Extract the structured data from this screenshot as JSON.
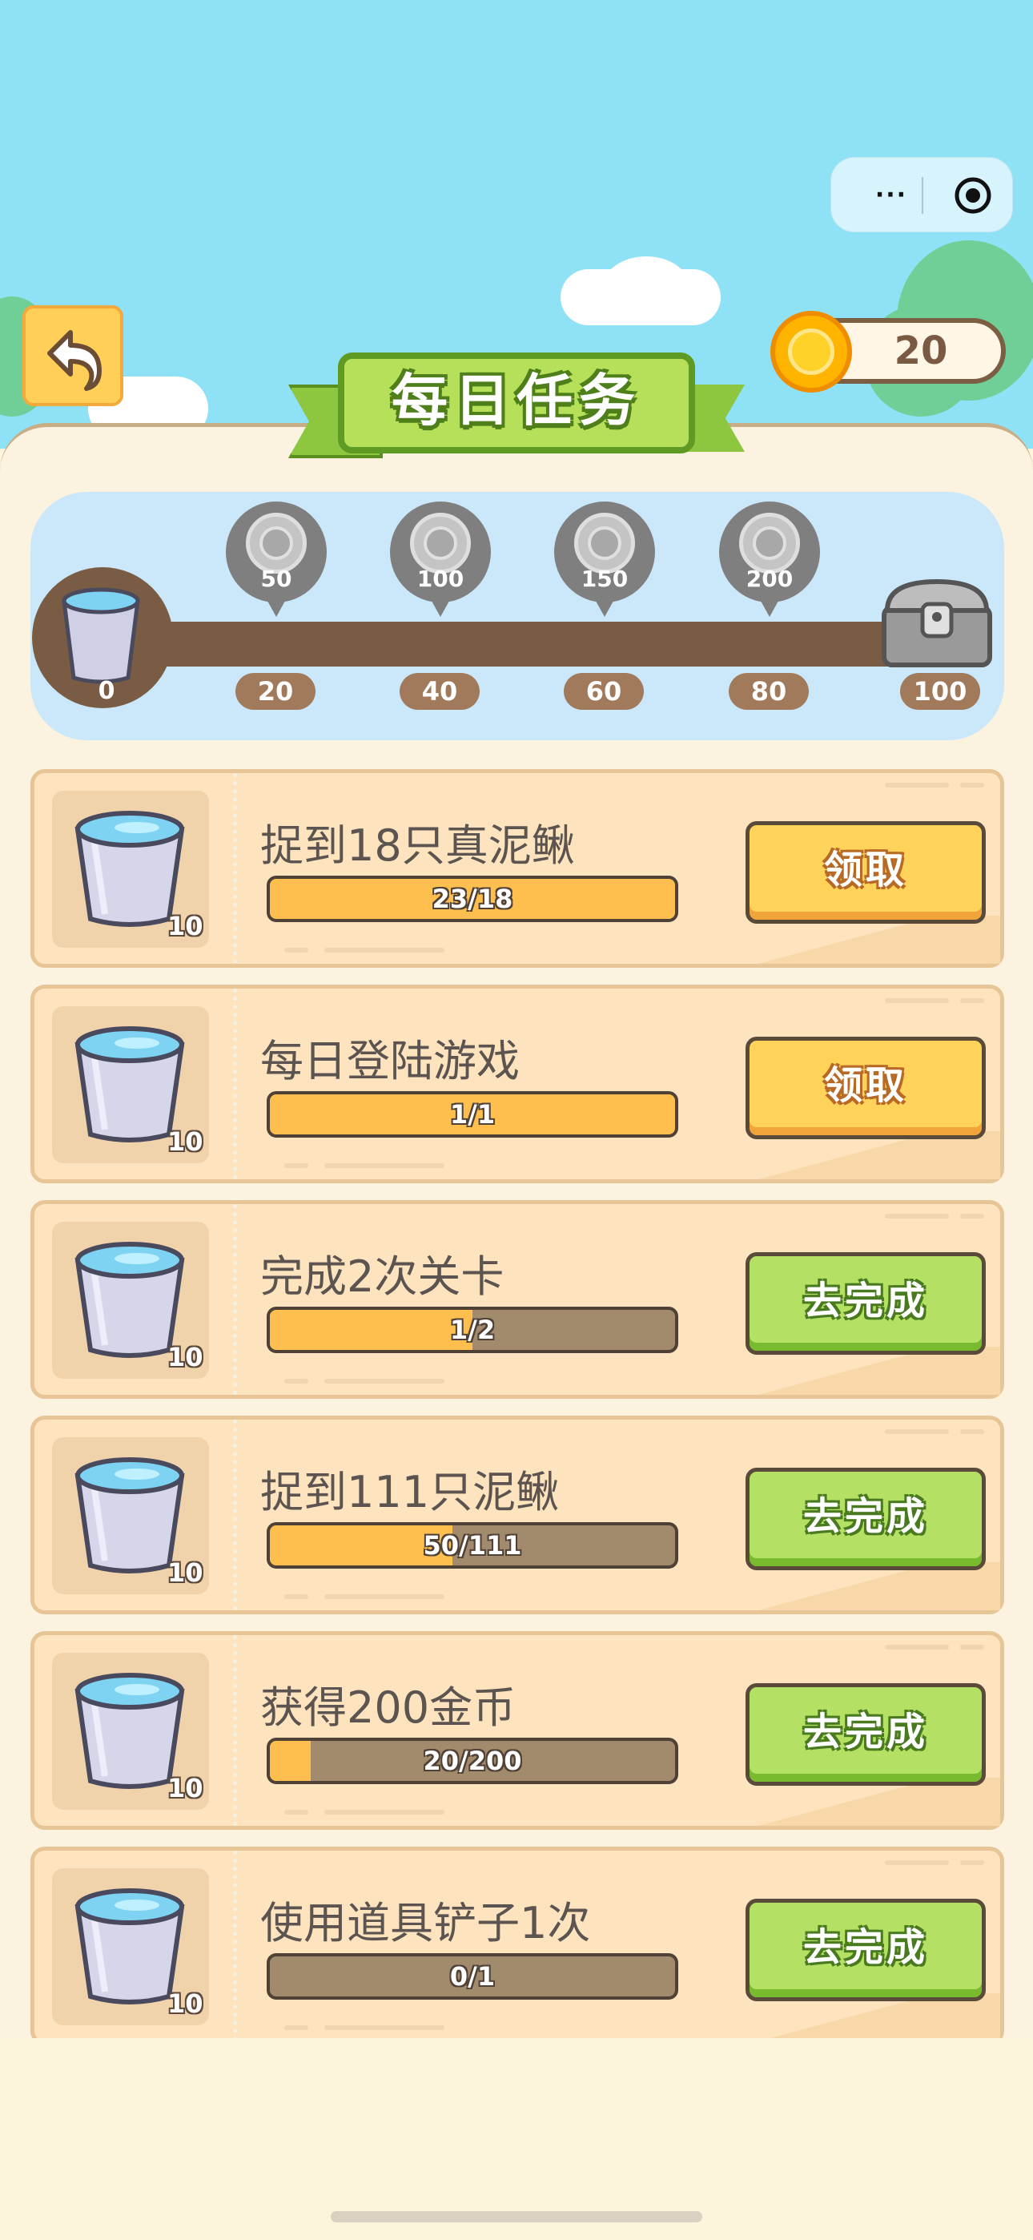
{
  "header": {
    "title": "每日任务",
    "coins": "20",
    "menu_dots": "···"
  },
  "milestones": {
    "start": "0",
    "points": [
      "20",
      "40",
      "60",
      "80",
      "100"
    ],
    "rewards": [
      "50",
      "100",
      "150",
      "200"
    ]
  },
  "tasks": [
    {
      "name": "捉到18只真泥鳅",
      "progress_text": "23/18",
      "progress": 1.0,
      "reward": "10",
      "button": "领取",
      "state": "claim"
    },
    {
      "name": "每日登陆游戏",
      "progress_text": "1/1",
      "progress": 1.0,
      "reward": "10",
      "button": "领取",
      "state": "claim"
    },
    {
      "name": "完成2次关卡",
      "progress_text": "1/2",
      "progress": 0.5,
      "reward": "10",
      "button": "去完成",
      "state": "go"
    },
    {
      "name": "捉到111只泥鳅",
      "progress_text": "50/111",
      "progress": 0.45,
      "reward": "10",
      "button": "去完成",
      "state": "go"
    },
    {
      "name": "获得200金币",
      "progress_text": "20/200",
      "progress": 0.1,
      "reward": "10",
      "button": "去完成",
      "state": "go"
    },
    {
      "name": "使用道具铲子1次",
      "progress_text": "0/1",
      "progress": 0.0,
      "reward": "10",
      "button": "去完成",
      "state": "go"
    }
  ]
}
